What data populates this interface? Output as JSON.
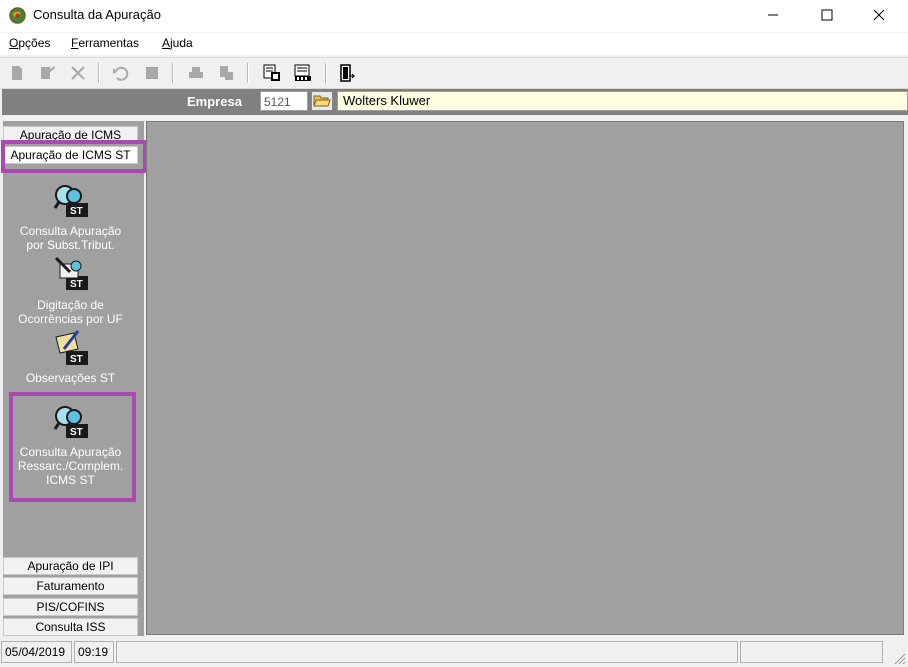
{
  "window": {
    "title": "Consulta da Apuração"
  },
  "menu": {
    "items": [
      {
        "pre": "",
        "ul": "O",
        "post": "pções"
      },
      {
        "pre": "",
        "ul": "F",
        "post": "erramentas"
      },
      {
        "pre": "",
        "ul": "A",
        "post": "juda"
      }
    ]
  },
  "empresa": {
    "label": "Empresa",
    "code": "5121",
    "name": "Wolters Kluwer"
  },
  "sidebar": {
    "top_buttons": [
      "Apuração de ICMS",
      "Apuração de ICMS ST"
    ],
    "items": [
      {
        "label_lines": [
          "Consulta  Apuração",
          "por Subst.Tribut."
        ],
        "icon": "consulta-st-icon"
      },
      {
        "label_lines": [
          "Digitação de",
          "Ocorrências por UF"
        ],
        "icon": "digitacao-st-icon"
      },
      {
        "label_lines": [
          "Observações ST"
        ],
        "icon": "observacoes-st-icon"
      },
      {
        "label_lines": [
          "Consulta Apuração",
          "Ressarc./Complem.",
          "ICMS ST"
        ],
        "icon": "consulta-ressarc-st-icon"
      }
    ],
    "bottom_buttons": [
      "Apuração de IPI",
      "Faturamento",
      "PIS/COFINS",
      "Consulta ISS"
    ]
  },
  "status": {
    "date": "05/04/2019",
    "time": "09:19"
  },
  "colors": {
    "highlight": "#a84ab0",
    "panel": "#a0a0a0",
    "empresa_bg": "#808080",
    "name_bg": "#ffffe1"
  }
}
